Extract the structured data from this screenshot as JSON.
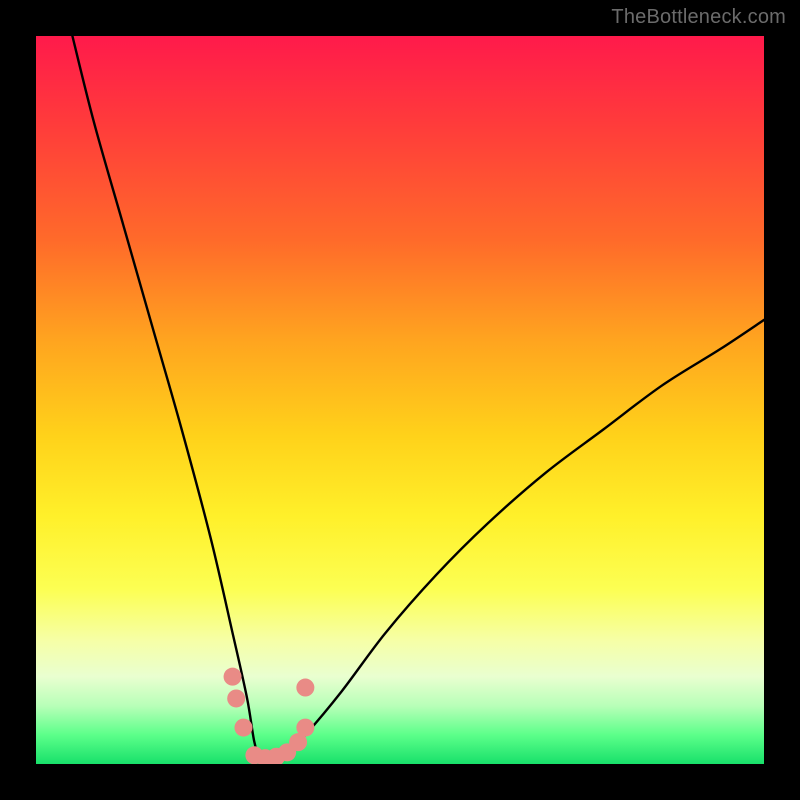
{
  "watermark": "TheBottleneck.com",
  "chart_data": {
    "type": "line",
    "title": "",
    "xlabel": "",
    "ylabel": "",
    "xlim": [
      0,
      100
    ],
    "ylim": [
      0,
      100
    ],
    "series": [
      {
        "name": "bottleneck-curve",
        "x": [
          5,
          8,
          12,
          16,
          20,
          24,
          27,
          29,
          30,
          31,
          32,
          34,
          37,
          42,
          48,
          55,
          62,
          70,
          78,
          86,
          94,
          100
        ],
        "y": [
          100,
          88,
          74,
          60,
          46,
          31,
          18,
          9,
          3,
          0,
          0,
          1,
          4,
          10,
          18,
          26,
          33,
          40,
          46,
          52,
          57,
          61
        ]
      }
    ],
    "markers": {
      "name": "highlight-dots",
      "color": "#e98b86",
      "points": [
        {
          "x": 27.0,
          "y": 12
        },
        {
          "x": 27.5,
          "y": 9
        },
        {
          "x": 28.5,
          "y": 5
        },
        {
          "x": 30.0,
          "y": 1.2
        },
        {
          "x": 31.5,
          "y": 0.8
        },
        {
          "x": 33.0,
          "y": 1.0
        },
        {
          "x": 34.5,
          "y": 1.6
        },
        {
          "x": 36.0,
          "y": 3.0
        },
        {
          "x": 37.0,
          "y": 5.0
        },
        {
          "x": 37.0,
          "y": 10.5
        }
      ]
    }
  }
}
